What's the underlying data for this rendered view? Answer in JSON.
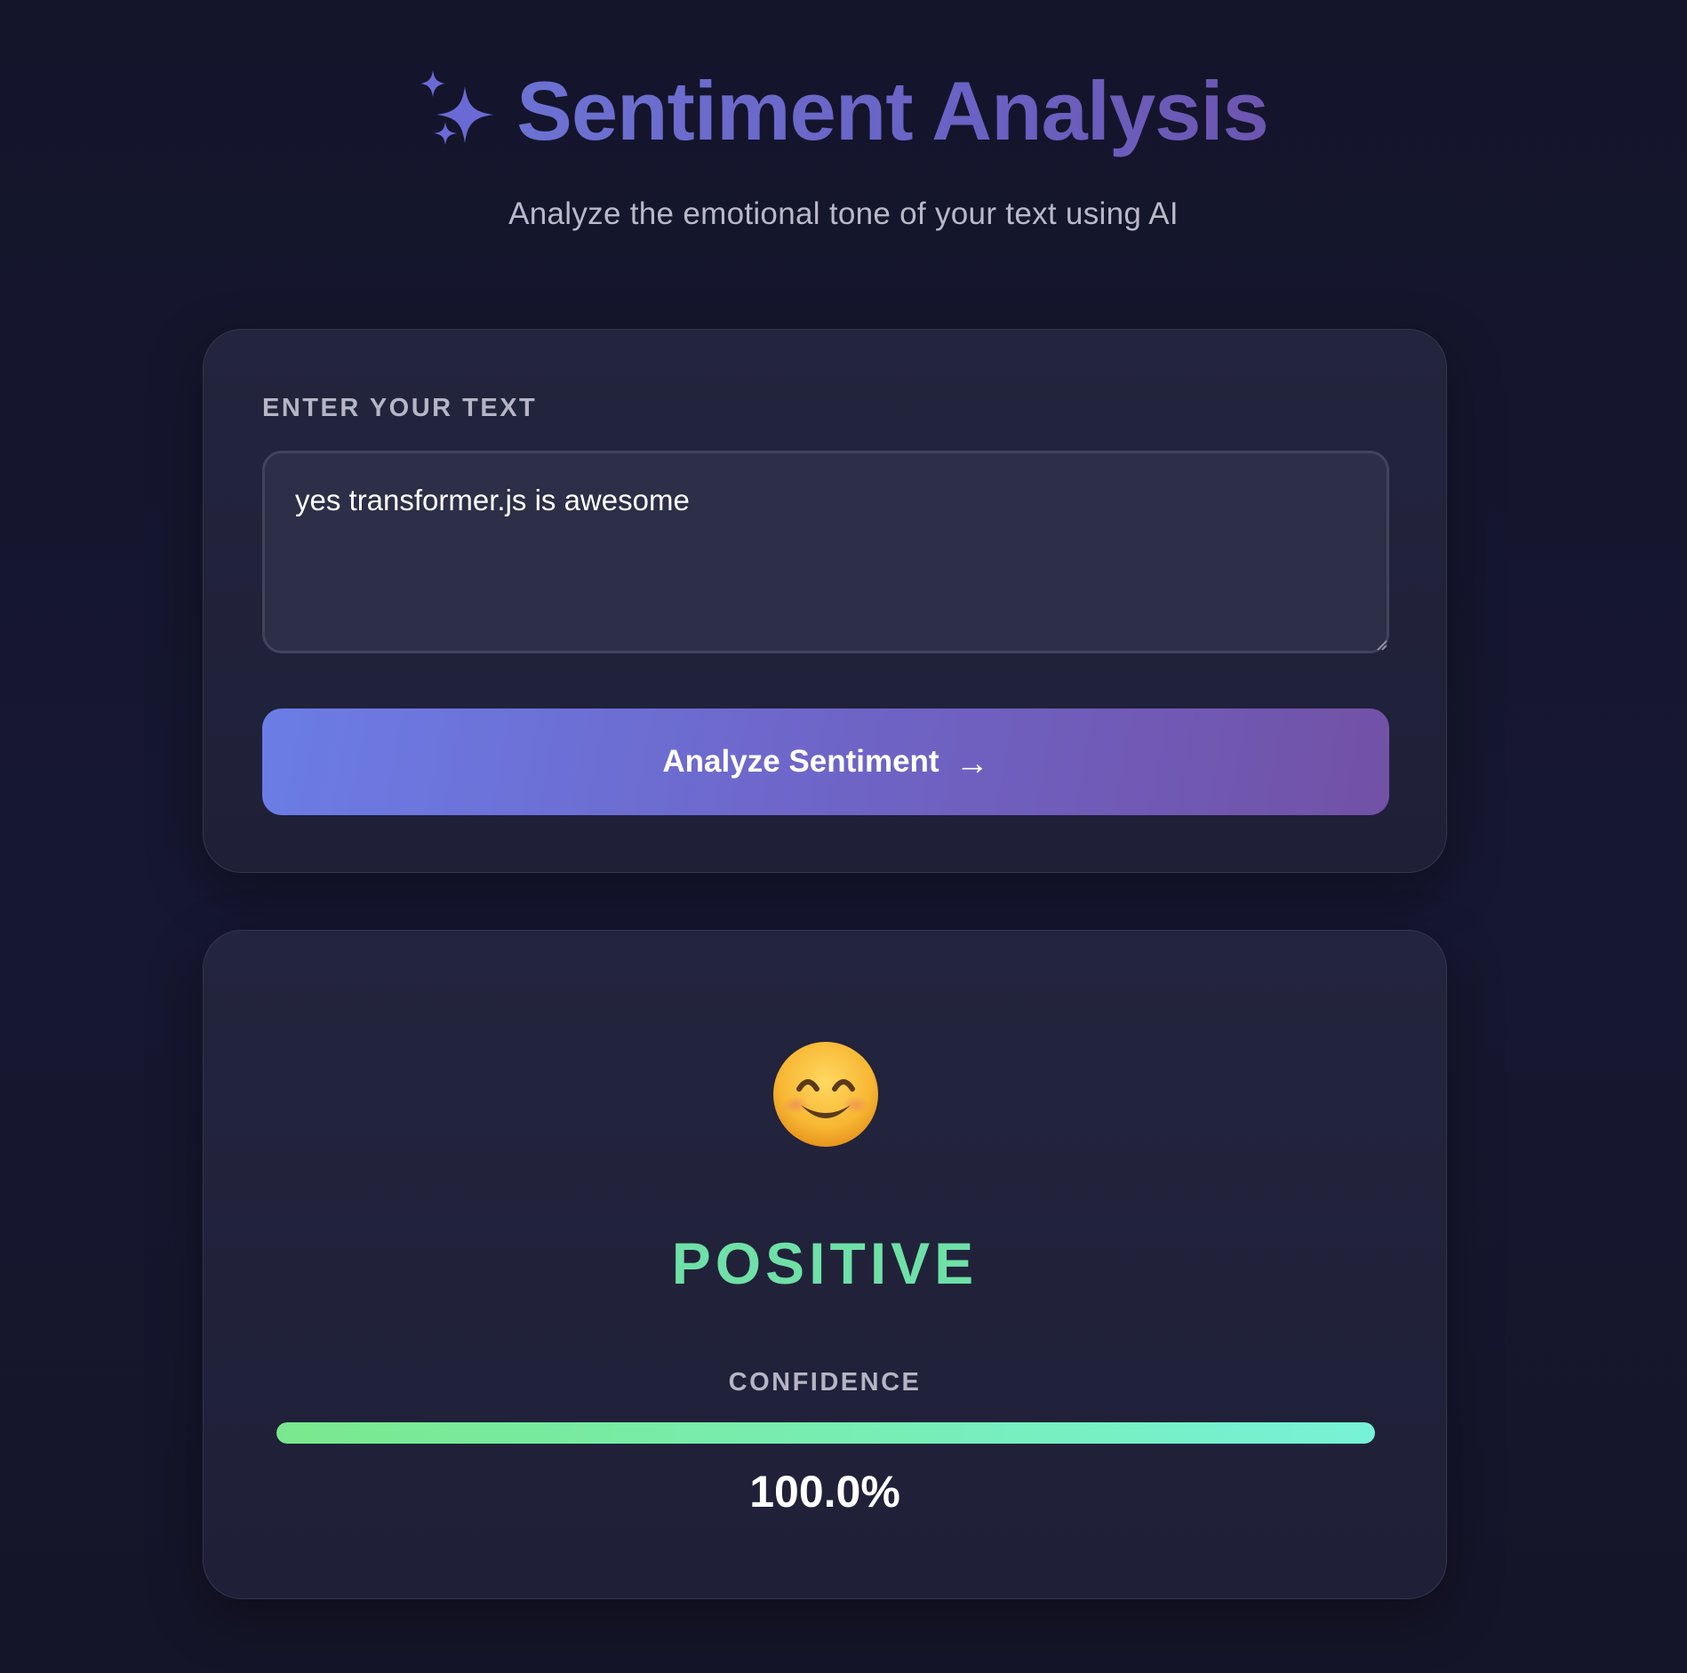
{
  "header": {
    "icon": "sparkles-icon",
    "title": "Sentiment Analysis",
    "subtitle": "Analyze the emotional tone of your text using AI"
  },
  "input_card": {
    "label": "ENTER YOUR TEXT",
    "text_value": "yes transformer.js is awesome",
    "button_label": "Analyze Sentiment",
    "button_icon": "→"
  },
  "result": {
    "emoji": "smiling-face-icon",
    "sentiment": "POSITIVE",
    "confidence_label": "CONFIDENCE",
    "confidence_value": "100.0%",
    "confidence_fraction": 1.0
  },
  "colors": {
    "accent_start": "#6b7de6",
    "accent_end": "#7251a6",
    "positive": "#6fe0a7",
    "bar_start": "#79e88d",
    "bar_end": "#76f2d6"
  }
}
